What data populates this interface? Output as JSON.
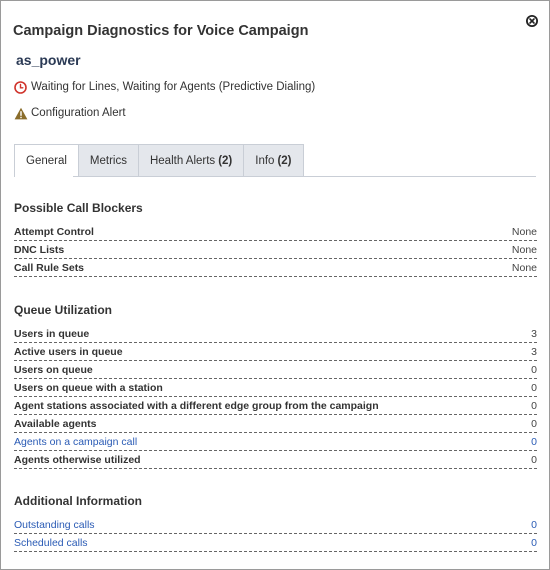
{
  "header": {
    "title": "Campaign Diagnostics for Voice Campaign",
    "close_icon": "close-circle-icon",
    "campaign_name": "as_power"
  },
  "status": {
    "dialing_text": "Waiting for Lines, Waiting for Agents (Predictive Dialing)",
    "dialing_icon": "clock-icon",
    "dialing_icon_color": "#d0342c",
    "alert_text": "Configuration Alert",
    "alert_icon": "warning-icon",
    "alert_icon_color": "#8a6d2b"
  },
  "tabs": [
    {
      "label": "General",
      "count": "",
      "active": true
    },
    {
      "label": "Metrics",
      "count": "",
      "active": false
    },
    {
      "label": "Health Alerts",
      "count": "(2)",
      "active": false
    },
    {
      "label": "Info",
      "count": "(2)",
      "active": false
    }
  ],
  "call_blockers": {
    "title": "Possible Call Blockers",
    "rows": [
      {
        "label": "Attempt Control",
        "value": "None"
      },
      {
        "label": "DNC Lists",
        "value": "None"
      },
      {
        "label": "Call Rule Sets",
        "value": "None"
      }
    ]
  },
  "queue_utilization": {
    "title": "Queue Utilization",
    "rows": [
      {
        "label": "Users in queue",
        "value": "3"
      },
      {
        "label": "Active users in queue",
        "value": "3"
      },
      {
        "label": "Users on queue",
        "value": "0"
      },
      {
        "label": "Users on queue with a station",
        "value": "0"
      },
      {
        "label": "Agent stations associated with a different edge group from the campaign",
        "value": "0"
      },
      {
        "label": "Available agents",
        "value": "0"
      },
      {
        "label": "Agents on a campaign call",
        "value": "0"
      },
      {
        "label": "Agents otherwise utilized",
        "value": "0"
      }
    ]
  },
  "additional_info": {
    "title": "Additional Information",
    "rows": [
      {
        "label": "Outstanding calls",
        "value": "0"
      },
      {
        "label": "Scheduled calls",
        "value": "0"
      }
    ]
  },
  "colors": {
    "link": "#2a5bb5",
    "title_text": "#333333",
    "campaign_name": "#2b3a55",
    "tab_inactive_bg": "#e4e7ec"
  }
}
